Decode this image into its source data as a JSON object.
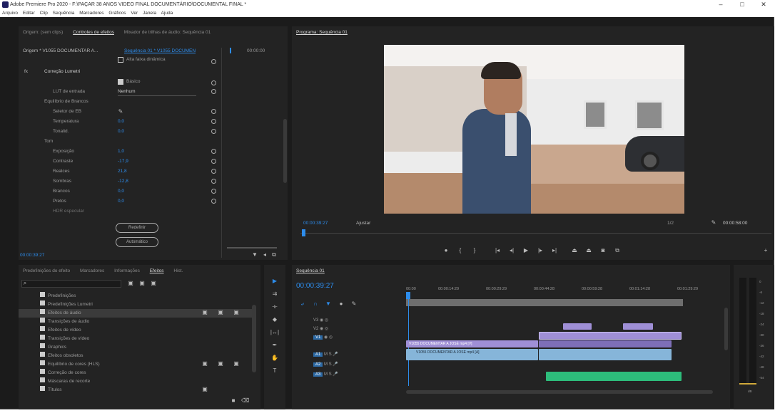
{
  "window": {
    "title": "Adobe Premiere Pro 2020 - F:\\PAÇAR 38 ANOS VIDEO FINAL DOCUMENTÁRIO\\DOCUMENTAL FINAL *",
    "minimize": "–",
    "maximize": "□",
    "close": "✕"
  },
  "menu": [
    "Arquivo",
    "Editar",
    "Clip",
    "Sequência",
    "Marcadores",
    "Gráficos",
    "Ver",
    "Janela",
    "Ajuda"
  ],
  "effects_panel": {
    "tabs": [
      "Origem: (sem clips)",
      "Controles de efeitos",
      "Mixador de trilhas de áudio: Sequência 01"
    ],
    "active_tab": 1,
    "source_label": "Origem * V1055 DOCUMENTAR A...",
    "sequence_label": "Sequência 01 * V1055 DOCUMEN",
    "timecode_top": "00:00:00",
    "section": "Correção Lumetri",
    "fx_label": "fx",
    "checkbox_hdr": "Alta faixa dinâmica",
    "checkbox_basic": "Básico",
    "lut_label": "LUT de entrada",
    "lut_value": "Nenhum",
    "white_balance": "Equilíbrio de Brancos",
    "wb_selector": "Seletor de EB",
    "temperature_label": "Temperatura",
    "temperature_value": "0,0",
    "tint_label": "Tonalid.",
    "tint_value": "0,0",
    "tone_label": "Tom",
    "exposure_label": "Exposição",
    "exposure_value": "1,0",
    "contrast_label": "Contraste",
    "contrast_value": "-17,9",
    "highlights_label": "Realces",
    "highlights_value": "21,8",
    "shadows_label": "Sombras",
    "shadows_value": "-12,8",
    "whites_label": "Brancos",
    "whites_value": "0,0",
    "blacks_label": "Pretos",
    "blacks_value": "0,0",
    "hdr_label": "HDR especular",
    "btn_reset": "Redefinir",
    "btn_auto": "Automático",
    "bottom_timecode": "00:00:39:27"
  },
  "program": {
    "tab": "Programa: Sequência 01",
    "timecode": "00:00:39:27",
    "fit": "Ajustar",
    "scale": "1/2",
    "duration": "00:00:58:00"
  },
  "project_panel": {
    "tabs": [
      "Predefinições do efeito",
      "Marcadores",
      "Informações",
      "Efeitos",
      "Hist."
    ],
    "active_tab": 3,
    "search_placeholder": "",
    "items": [
      "Predefinições",
      "Predefinições Lumetri",
      "Efeitos de áudio",
      "Transições de áudio",
      "Efeitos de vídeo",
      "Transições de vídeo",
      "Graphics",
      "Efeitos obsoletos",
      "Equilíbrio de cores (HLS)",
      "Correção de cores",
      "Máscaras de recorte",
      "Títulos"
    ]
  },
  "timeline": {
    "tab": "Sequência 01",
    "timecode": "00:00:39:27",
    "ruler": [
      "00:00",
      "00:00:14:29",
      "00:00:29:29",
      "00:00:44:28",
      "00:00:59:28",
      "00:01:14:28",
      "00:01:29:29",
      "00:01:44:29"
    ],
    "video_tracks": [
      "V3",
      "V2",
      "V1"
    ],
    "audio_tracks": [
      "A1",
      "A2",
      "A3"
    ],
    "clip_v1": "V1055 DOCUMENTAR A JOSÉ mp4 [V]",
    "clip_a1": "V1055 DOCUMENTAR A JOSÉ mp4 [A]",
    "colors": {
      "video": "#9f8fd6",
      "audio": "#86b5d9",
      "green": "#2dbd7b",
      "playhead": "#3b8be8",
      "accent": "#2d8ceb"
    }
  },
  "meter": {
    "labels": [
      "0",
      "-6",
      "-12",
      "-18",
      "-24",
      "-30",
      "-36",
      "-42",
      "-48",
      "-54",
      "dB"
    ]
  },
  "tools": [
    "selection-icon",
    "track-select-icon",
    "ripple-edit-icon",
    "razor-icon",
    "slip-icon",
    "pen-icon",
    "hand-icon",
    "type-icon"
  ]
}
